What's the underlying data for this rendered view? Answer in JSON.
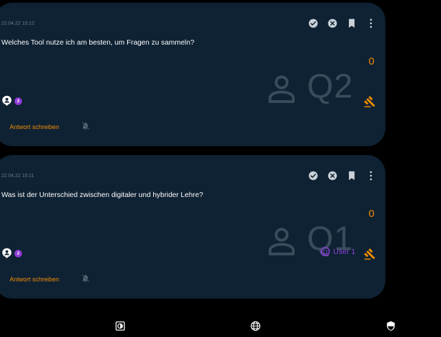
{
  "colors": {
    "background": "#000000",
    "card": "#0f2234",
    "accent": "#f28c00",
    "purple": "#8f3bd6",
    "muted": "#6d7d8c",
    "watermark": "#3a4c5c"
  },
  "questions": [
    {
      "timestamp": "22.04.22 15:12",
      "text": "Welches Tool nutze ich am besten, um Fragen zu sammeln?",
      "score": "0",
      "watermark": "Q2",
      "badge_count": "2",
      "answer_label": "Antwort schreiben",
      "user_label": "",
      "icons": [
        "check-circle-icon",
        "cancel-circle-icon",
        "bookmark-icon",
        "more-vert-icon",
        "gavel-icon",
        "person-pin-icon",
        "notifications-off-icon"
      ]
    },
    {
      "timestamp": "22.04.22 15:11",
      "text": "Was ist der Unterschied zwischen digitaler und hybrider Lehre?",
      "score": "0",
      "watermark": "Q1",
      "badge_count": "2",
      "answer_label": "Antwort schreiben",
      "user_label": "User 1",
      "icons": [
        "check-circle-icon",
        "cancel-circle-icon",
        "bookmark-icon",
        "more-vert-icon",
        "gavel-icon",
        "person-pin-icon",
        "notifications-off-icon",
        "user-smiley-icon"
      ]
    }
  ],
  "bottom_bar": {
    "icons": [
      "contrast-icon",
      "language-globe-icon",
      "security-shield-icon"
    ]
  }
}
